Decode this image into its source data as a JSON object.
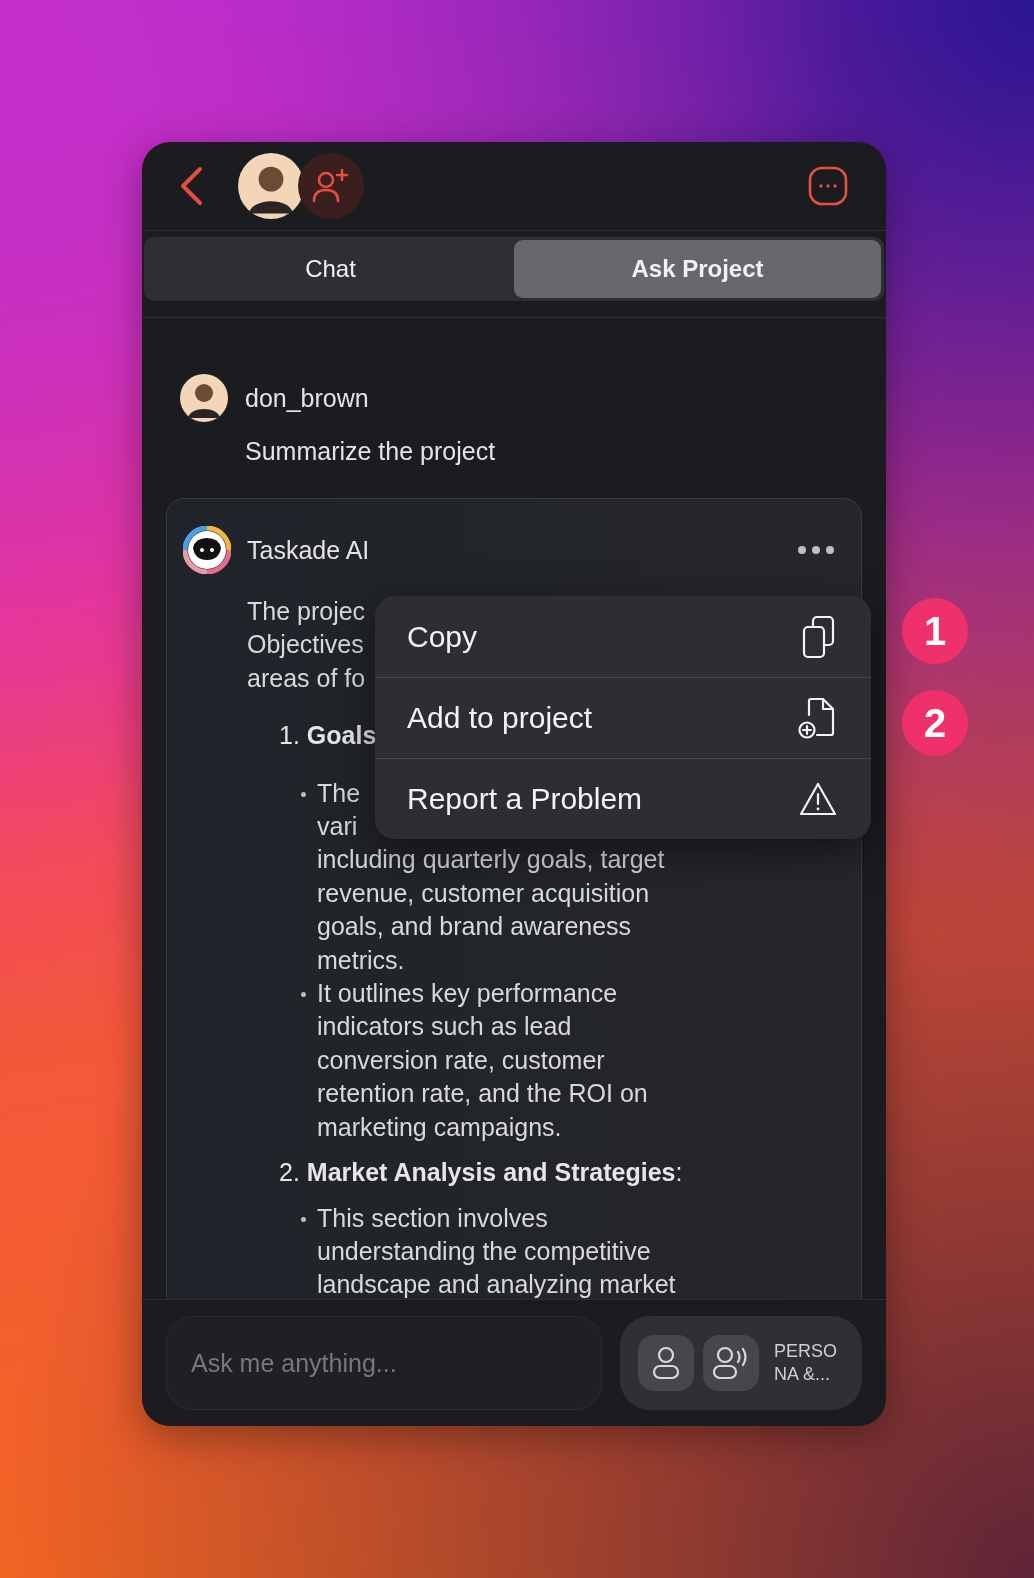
{
  "tabs": [
    {
      "label": "Chat",
      "selected": false
    },
    {
      "label": "Ask Project",
      "selected": true
    }
  ],
  "user_message": {
    "author": "don_brown",
    "text": "Summarize the project"
  },
  "ai_message": {
    "author": "Taskade AI",
    "intro_lines": [
      "The projec",
      "Objectives",
      "areas of fo"
    ],
    "sections": [
      {
        "number": "1.",
        "title": "Goals",
        "bullets": [
          [
            "The",
            "vari",
            "including quarterly goals, target",
            "revenue, customer acquisition",
            "goals, and brand awareness",
            "metrics."
          ],
          [
            "It outlines key performance",
            "indicators such as lead",
            "conversion rate, customer",
            "retention rate, and the ROI on",
            "marketing campaigns."
          ]
        ]
      },
      {
        "number": "2.",
        "title": "Market Analysis and Strategies",
        "suffix": ":",
        "bullets": [
          [
            "This section involves",
            "understanding the competitive",
            "landscape and analyzing market"
          ]
        ]
      }
    ]
  },
  "context_menu": [
    {
      "label": "Copy",
      "kind": "copy"
    },
    {
      "label": "Add to project",
      "kind": "add"
    },
    {
      "label": "Report a Problem",
      "kind": "report"
    }
  ],
  "callouts": [
    "1",
    "2"
  ],
  "composer": {
    "placeholder": "Ask me anything...",
    "persona_lines": [
      "PERSO",
      "NA &..."
    ]
  }
}
